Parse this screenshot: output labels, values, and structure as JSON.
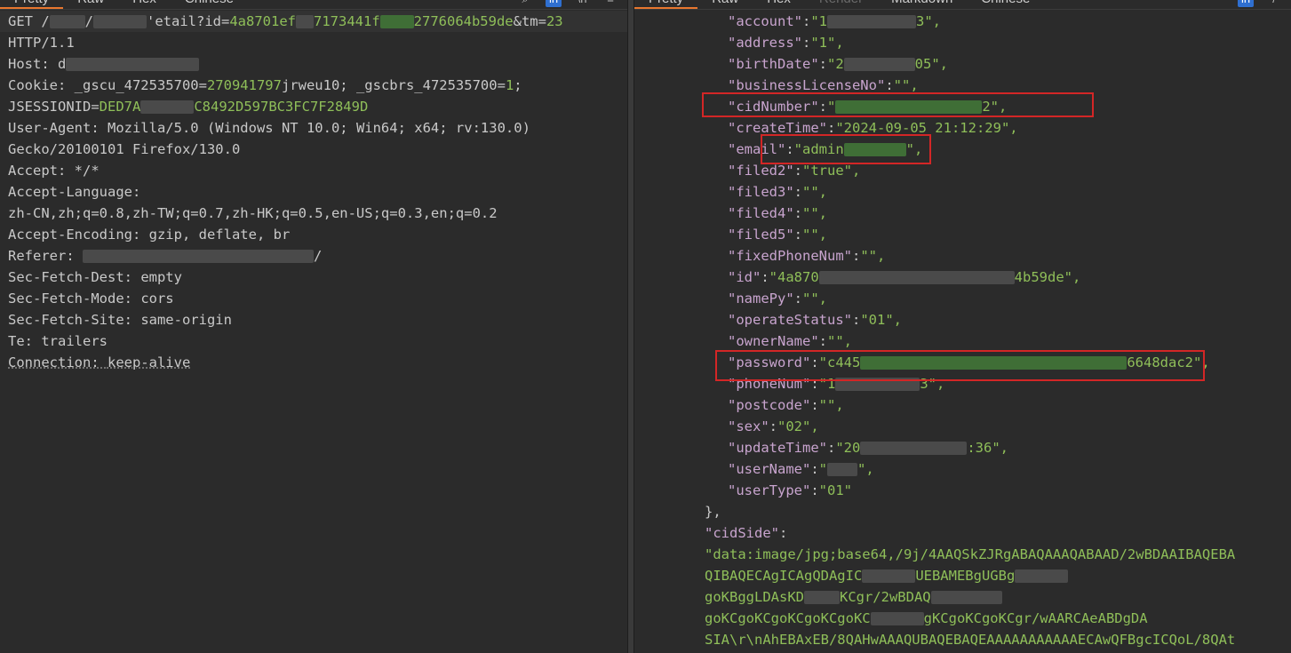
{
  "left_tabs": {
    "items": [
      {
        "label": "Pretty",
        "active": true
      },
      {
        "label": "Raw",
        "active": false
      },
      {
        "label": "Hex",
        "active": false
      },
      {
        "label": "Chinese",
        "active": false
      }
    ]
  },
  "right_tabs": {
    "items": [
      {
        "label": "Pretty",
        "active": true
      },
      {
        "label": "Raw",
        "active": false
      },
      {
        "label": "Hex",
        "active": false
      },
      {
        "label": "Render",
        "disabled": true
      },
      {
        "label": "Markdown",
        "active": false
      },
      {
        "label": "Chinese",
        "active": false
      }
    ]
  },
  "request": {
    "line1_a": "GET /",
    "line1_b": "/",
    "line1_c": "'etail?id=",
    "line1_id_a": "4a8701ef",
    "line1_id_b": "7173441f",
    "line1_id_c": "2776064b59de",
    "line1_tm": "&tm=",
    "line1_tm_val": "23",
    "line2": "HTTP/1.1",
    "host_key": "Host: ",
    "host_val": "d",
    "cookie_key": "Cookie: ",
    "cookie_a": "_gscu_472535700=",
    "cookie_b": "270941797",
    "cookie_c": "jrweu10; _gscbrs_472535700=",
    "cookie_d": "1",
    "cookie_e": ";",
    "jsession_key": "JSESSIONID=",
    "jsession_a": "DED7A",
    "jsession_b": "C8492D597BC3FC7F2849D",
    "ua_key": "User-Agent: ",
    "ua_val": "Mozilla/5.0 (Windows NT 10.0; Win64; x64; rv:130.0)",
    "ua_cont": "Gecko/20100101 Firefox/130.0",
    "accept_key": "Accept: ",
    "accept_val": "*/*",
    "al_key": "Accept-Language:",
    "al_val": "zh-CN,zh;q=0.8,zh-TW;q=0.7,zh-HK;q=0.5,en-US;q=0.3,en;q=0.2",
    "ae_key": "Accept-Encoding: ",
    "ae_val": "gzip, deflate, br",
    "ref_key": "Referer: ",
    "ref_tail": "/",
    "sfd_key": "Sec-Fetch-Dest: ",
    "sfd_val": "empty",
    "sfm_key": "Sec-Fetch-Mode: ",
    "sfm_val": "cors",
    "sfs_key": "Sec-Fetch-Site: ",
    "sfs_val": "same-origin",
    "te_key": "Te: ",
    "te_val": "trailers",
    "conn_key": "Connection: ",
    "conn_val": "keep-alive"
  },
  "response": {
    "fields": [
      {
        "key": "\"account\"",
        "val": "\"1",
        "tail": "3\","
      },
      {
        "key": "\"address\"",
        "val": "\"1\","
      },
      {
        "key": "\"birthDate\"",
        "val": "\"2",
        "tail": "05\","
      },
      {
        "key": "\"businessLicenseNo\"",
        "val": "\"\","
      },
      {
        "key": "\"cidNumber\"",
        "val": "\"",
        "tail": "2\","
      },
      {
        "key": "\"createTime\"",
        "val": "\"2024-09-05 21:12:29\","
      },
      {
        "key": "\"email\"",
        "val": "\"admin",
        "tail": "\","
      },
      {
        "key": "\"filed2\"",
        "val": "\"true\","
      },
      {
        "key": "\"filed3\"",
        "val": "\"\","
      },
      {
        "key": "\"filed4\"",
        "val": "\"\","
      },
      {
        "key": "\"filed5\"",
        "val": "\"\","
      },
      {
        "key": "\"fixedPhoneNum\"",
        "val": "\"\","
      },
      {
        "key": "\"id\"",
        "val": "\"4a870",
        "tail": "4b59de\","
      },
      {
        "key": "\"namePy\"",
        "val": "\"\","
      },
      {
        "key": "\"operateStatus\"",
        "val": "\"01\","
      },
      {
        "key": "\"ownerName\"",
        "val": "\"\","
      },
      {
        "key": "\"password\"",
        "val": "\"c445",
        "tail": "6648dac2\","
      },
      {
        "key": "\"phoneNum\"",
        "val": "\"1",
        "tail": "3\","
      },
      {
        "key": "\"postcode\"",
        "val": "\"\","
      },
      {
        "key": "\"sex\"",
        "val": "\"02\","
      },
      {
        "key": "\"updateTime\"",
        "val": "\"20",
        "tail": ":36\","
      },
      {
        "key": "\"userName\"",
        "val": "\"",
        "tail": "\","
      },
      {
        "key": "\"userType\"",
        "val": "\"01\""
      }
    ],
    "close_brace": "},",
    "cidside_key": "\"cidSide\"",
    "cidside_colon": ":",
    "b64": [
      "\"data:image/jpg;base64,/9j/4AAQSkZJRgABAQAAAQABAAD/2wBDAAIBAQEBA",
      "QIBAQECAgICAgQDAgIC",
      "goKBggLDAsKD",
      "goKCgoKCgoKCgoKCgoKC",
      "SIA\\r\\nAhEBAxEB/8QAHwAAAQUBAQEBAQEAAAAAAAAAAAECAwQFBgcICQoL/8QAt"
    ],
    "b64_tails": [
      "",
      "UEBAMEBgUGBg",
      "KCgr/2wBDAQ",
      "gKCgoKCgoKCgr/wAARCAeABDgDA",
      ""
    ]
  }
}
